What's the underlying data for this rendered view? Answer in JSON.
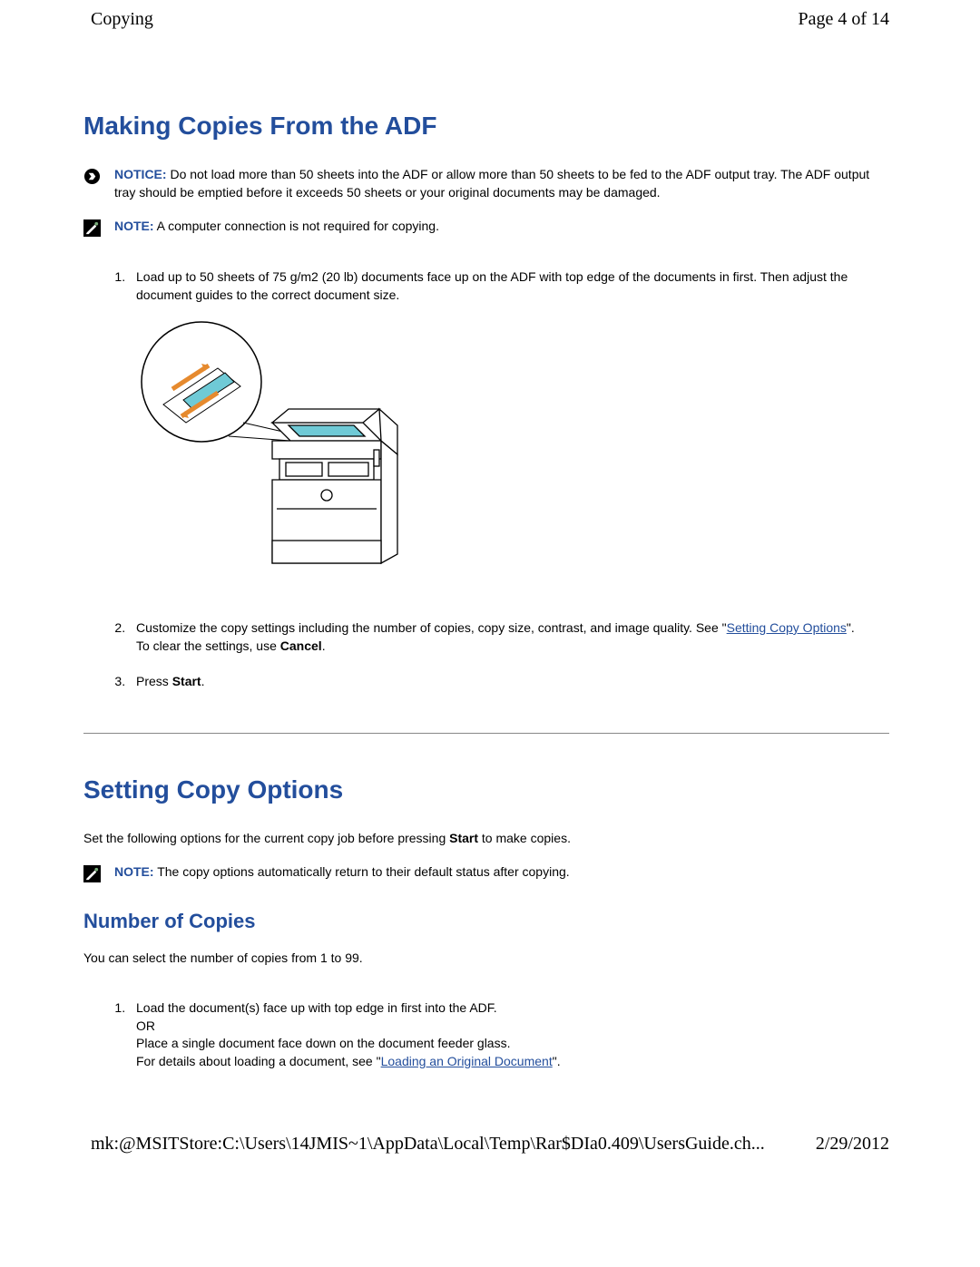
{
  "header": {
    "title": "Copying",
    "page_indicator": "Page 4 of 14"
  },
  "footer": {
    "path": "mk:@MSITStore:C:\\Users\\14JMIS~1\\AppData\\Local\\Temp\\Rar$DIa0.409\\UsersGuide.ch...",
    "date": "2/29/2012"
  },
  "section_adf": {
    "heading": "Making Copies From the ADF",
    "notice": {
      "label": "NOTICE:",
      "text": " Do not load more than 50 sheets into the ADF or allow more than 50 sheets to be fed to the ADF output tray. The ADF output tray should be emptied before it exceeds 50 sheets or your original documents may be damaged."
    },
    "note": {
      "label": "NOTE:",
      "text": " A computer connection is not required for copying."
    },
    "steps": {
      "s1": "Load up to 50 sheets of 75 g/m2 (20 lb) documents face up on the ADF with top edge of the documents in first. Then adjust the document guides to the correct document size.",
      "s2": {
        "prefix": "Customize the copy settings including the number of copies, copy size, contrast, and image quality. See \"",
        "link": "Setting Copy Options",
        "after_link": "\".",
        "line2_prefix": "To clear the settings, use ",
        "line2_bold": "Cancel",
        "line2_suffix": "."
      },
      "s3": {
        "prefix": "Press ",
        "bold": "Start",
        "suffix": "."
      }
    }
  },
  "section_options": {
    "heading": "Setting Copy Options",
    "intro_prefix": "Set the following options for the current copy job before pressing ",
    "intro_bold": "Start",
    "intro_suffix": " to make copies.",
    "note": {
      "label": "NOTE:",
      "text": " The copy options automatically return to their default status after copying."
    },
    "sub_number": {
      "heading": "Number of Copies",
      "intro": "You can select the number of copies from 1 to 99.",
      "step1": {
        "line1": "Load the document(s) face up with top edge in first into the ADF.",
        "line2": "OR",
        "line3": "Place a single document face down on the document feeder glass.",
        "line4_prefix": "For details about loading a document, see \"",
        "line4_link": "Loading an Original Document",
        "line4_suffix": "\"."
      }
    }
  }
}
